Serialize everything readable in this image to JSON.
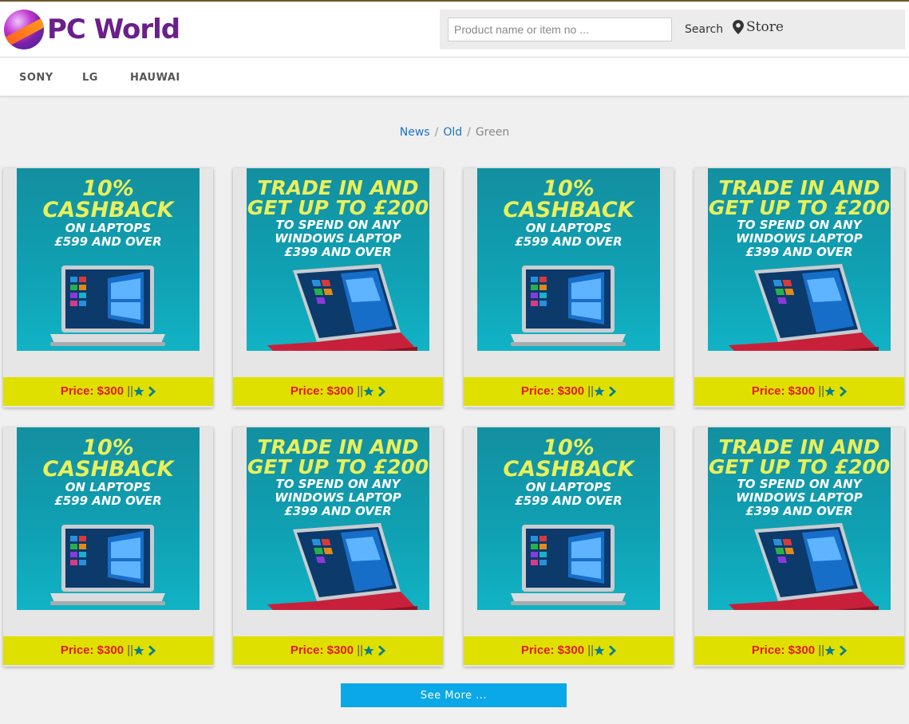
{
  "header": {
    "logo_text": "PC World",
    "search": {
      "placeholder": "Product name or item no ...",
      "value": ""
    },
    "search_label": "Search",
    "store_label": "Store"
  },
  "nav": {
    "items": [
      "SONY",
      "LG",
      "HAUWAI"
    ]
  },
  "breadcrumb": {
    "items": [
      "News",
      "Old"
    ],
    "current": "Green",
    "separator": "/"
  },
  "promos": {
    "cashback": {
      "line1": "10%",
      "line2": "CASHBACK",
      "line3": "ON LAPTOPS",
      "line4": "£599 AND OVER"
    },
    "tradein": {
      "line1": "TRADE IN AND",
      "line2": "GET UP TO £200",
      "line3": "TO SPEND ON ANY",
      "line4": "WINDOWS LAPTOP",
      "line5": "£399 AND OVER"
    }
  },
  "products": [
    {
      "promo": "cashback",
      "price_label": "Price: $300",
      "separator": "||"
    },
    {
      "promo": "tradein",
      "price_label": "Price: $300",
      "separator": "||"
    },
    {
      "promo": "cashback",
      "price_label": "Price: $300",
      "separator": "||"
    },
    {
      "promo": "tradein",
      "price_label": "Price: $300",
      "separator": "||"
    },
    {
      "promo": "cashback",
      "price_label": "Price: $300",
      "separator": "||"
    },
    {
      "promo": "tradein",
      "price_label": "Price: $300",
      "separator": "||"
    },
    {
      "promo": "cashback",
      "price_label": "Price: $300",
      "separator": "||"
    },
    {
      "promo": "tradein",
      "price_label": "Price: $300",
      "separator": "||"
    }
  ],
  "see_more_label": "See More ...",
  "colors": {
    "accent": "#0ba8e8",
    "price_bar": "#dfe000",
    "price_text": "#e21b1b",
    "icon": "#0a7f8a",
    "link": "#1a73c7"
  }
}
